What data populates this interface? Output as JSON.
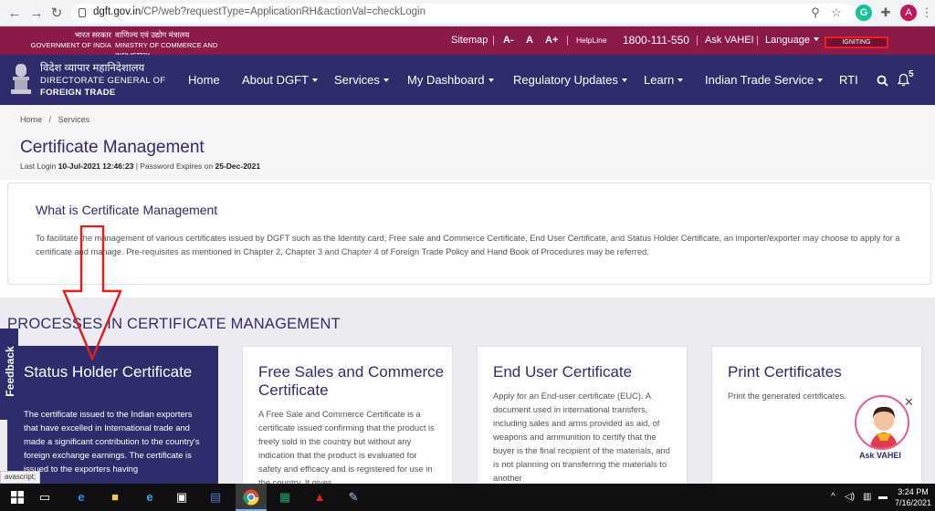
{
  "browser": {
    "url_host": "dgft.gov.in",
    "url_path": "/CP/web?requestType=ApplicationRH&actionVal=checkLogin",
    "profile_initial": "A",
    "grammarly_label": "G"
  },
  "top_strip": {
    "gov_hindi": "भारत सरकार",
    "gov_english": "GOVERNMENT OF INDIA",
    "ministry_hindi": "वाणिज्य एवं उद्योग मंत्रालय",
    "ministry_english": "MINISTRY OF COMMERCE AND INDUSTRY",
    "sitemap": "Sitemap",
    "font_decrease": "A-",
    "font_normal": "A",
    "font_increase": "A+",
    "helpline_label": "HelpLine",
    "helpline_number": "1800-111-550",
    "ask_vahei": "Ask VAHEI",
    "language": "Language",
    "igniting": "IGNITING",
    "separator": "|"
  },
  "header": {
    "dept_hindi": "विदेश व्यापार महानिदेशालय",
    "dept_english_1": "DIRECTORATE GENERAL OF",
    "dept_english_2": "FOREIGN TRADE",
    "nav": {
      "home": "Home",
      "about": "About DGFT",
      "services": "Services",
      "dashboard": "My Dashboard",
      "regulatory": "Regulatory Updates",
      "learn": "Learn",
      "trade_service": "Indian Trade Service",
      "rti": "RTI"
    },
    "notification_count": "5"
  },
  "breadcrumb": {
    "home": "Home",
    "separator": "/",
    "current": "Services"
  },
  "page": {
    "title": "Certificate Management",
    "last_login_label": "Last Login",
    "last_login_value": "10-Jul-2021 12:46:23",
    "password_label": "| Password Expires on",
    "password_value": "25-Dec-2021"
  },
  "info": {
    "title": "What is Certificate Management",
    "text": "To facilitate the management of various certificates issued by DGFT such as the Identity card, Free sale and Commerce Certificate, End User Certificate, and Status Holder Certificate, an importer/exporter may choose to apply for a certificate and manage. Pre-requisites as mentioned in Chapter 2, Chapter 3 and Chapter 4 of Foreign Trade Policy and Hand Book of Procedures may be referred."
  },
  "processes": {
    "title": "PROCESSES IN CERTIFICATE MANAGEMENT",
    "cards": [
      {
        "title": "Status Holder Certificate",
        "text": "The certificate issued to the Indian exporters that have excelled in International trade and made a significant contribution to the country's foreign exchange earnings. The certificate is issued to the exporters having"
      },
      {
        "title": "Free Sales and Commerce Certificate",
        "text": "A Free Sale and Commerce Certificate is a certificate issued confirming that the product is freely sold in the country but without any indication that the product is evaluated for safety and efficacy and is registered for use in the country. It gives"
      },
      {
        "title": "End User Certificate",
        "text": "Apply for an End-user certificate (EUC). A document used in international transfers, including sales and arms provided as aid, of weapons and ammunition to certify that the buyer is the final recipient of the materials, and is not planning on transferring the materials to another"
      },
      {
        "title": "Print Certificates",
        "text": "Print the generated certificates."
      }
    ]
  },
  "feedback": "Feedback",
  "status_tip": "avascript;",
  "vahei_label": "Ask VAHEI",
  "vahei_close": "✕",
  "taskbar": {
    "time": "3:24 PM",
    "date": "7/16/2021"
  }
}
